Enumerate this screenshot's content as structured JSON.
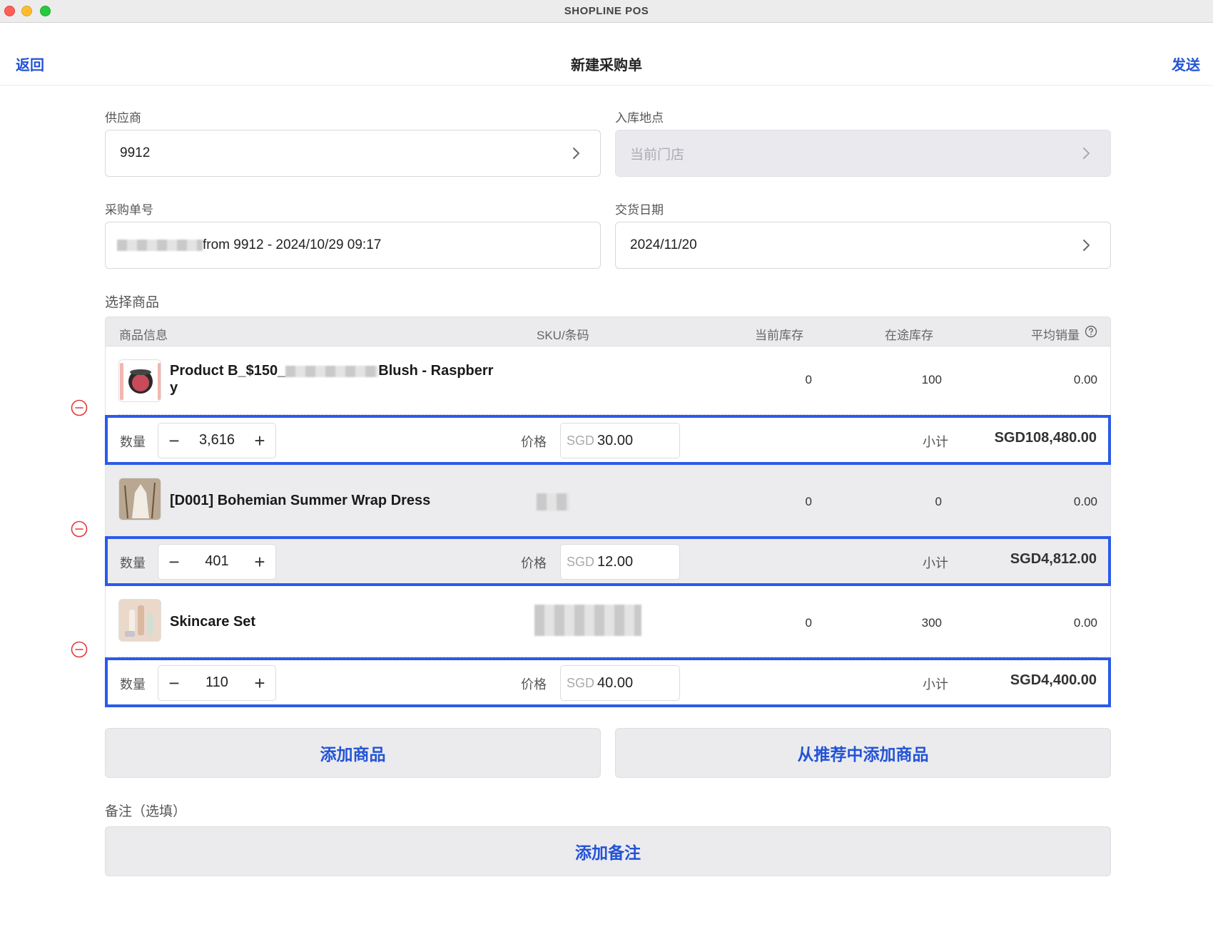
{
  "window": {
    "title": "SHOPLINE POS"
  },
  "nav": {
    "back": "返回",
    "title": "新建采购单",
    "send": "发送"
  },
  "form": {
    "supplier_label": "供应商",
    "supplier_value": "9912",
    "location_label": "入库地点",
    "location_value": "当前门店",
    "po_label": "采购单号",
    "po_value": "from 9912 - 2024/10/29 09:17",
    "date_label": "交货日期",
    "date_value": "2024/11/20"
  },
  "products_section": {
    "label": "选择商品",
    "columns": {
      "info": "商品信息",
      "sku": "SKU/条码",
      "stock": "当前库存",
      "transit": "在途库存",
      "avg": "平均销量"
    },
    "qty_label": "数量",
    "price_label": "价格",
    "subtotal_label": "小计",
    "currency": "SGD",
    "items": [
      {
        "name_line1": "Product B_$150_",
        "name_line1_end": "Blush - Raspberr",
        "name_line2": "y",
        "stock": "0",
        "transit": "100",
        "avg": "0.00",
        "qty": "3,616",
        "price": "30.00",
        "subtotal": "SGD108,480.00"
      },
      {
        "name": "[D001] Bohemian Summer Wrap Dress",
        "stock": "0",
        "transit": "0",
        "avg": "0.00",
        "qty": "401",
        "price": "12.00",
        "subtotal": "SGD4,812.00"
      },
      {
        "name": "Skincare Set",
        "stock": "0",
        "transit": "300",
        "avg": "0.00",
        "qty": "110",
        "price": "40.00",
        "subtotal": "SGD4,400.00"
      }
    ]
  },
  "actions": {
    "add_product": "添加商品",
    "add_recommended": "从推荐中添加商品"
  },
  "notes": {
    "label": "备注（选填）",
    "add_note": "添加备注"
  },
  "colors": {
    "accent": "#2353d6",
    "highlight_border": "#2a5be8",
    "remove_red": "#e03a3a"
  }
}
